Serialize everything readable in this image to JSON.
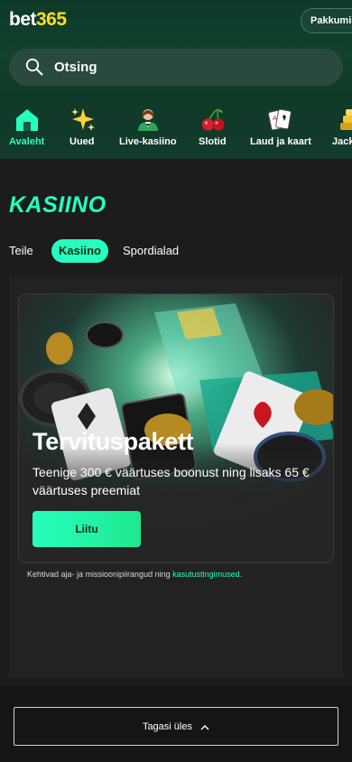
{
  "header": {
    "logo_white": "bet",
    "logo_yellow": "365",
    "offers_label": "Pakkumised"
  },
  "search": {
    "placeholder": "Otsing"
  },
  "nav": [
    {
      "label": "Avaleht",
      "icon": "home-icon",
      "active": true
    },
    {
      "label": "Uued",
      "icon": "sparkles-icon"
    },
    {
      "label": "Live-kasiino",
      "icon": "dealer-icon"
    },
    {
      "label": "Slotid",
      "icon": "cherry-icon"
    },
    {
      "label": "Laud ja kaart",
      "icon": "cards-icon"
    },
    {
      "label": "Jackpotid",
      "icon": "jackpot-icon"
    }
  ],
  "section_title": "KASIINO",
  "tabs": [
    {
      "label": "Teile"
    },
    {
      "label": "Kasiino",
      "active": true
    },
    {
      "label": "Spordialad"
    }
  ],
  "promo": {
    "title": "Tervituspakett",
    "subtitle": "Teenige 300 € väärtuses boonust ning lisaks 65 € väärtuses preemiat",
    "button": "Liitu"
  },
  "terms": {
    "text": "Kehtivad aja- ja missioonipiirangud ning ",
    "link": "kasutustingimused."
  },
  "footer": {
    "back_to_top": "Tagasi üles"
  },
  "colors": {
    "accent": "#26ffbe",
    "logo_yellow": "#ffdf1b",
    "header_bg": "#11422e"
  }
}
